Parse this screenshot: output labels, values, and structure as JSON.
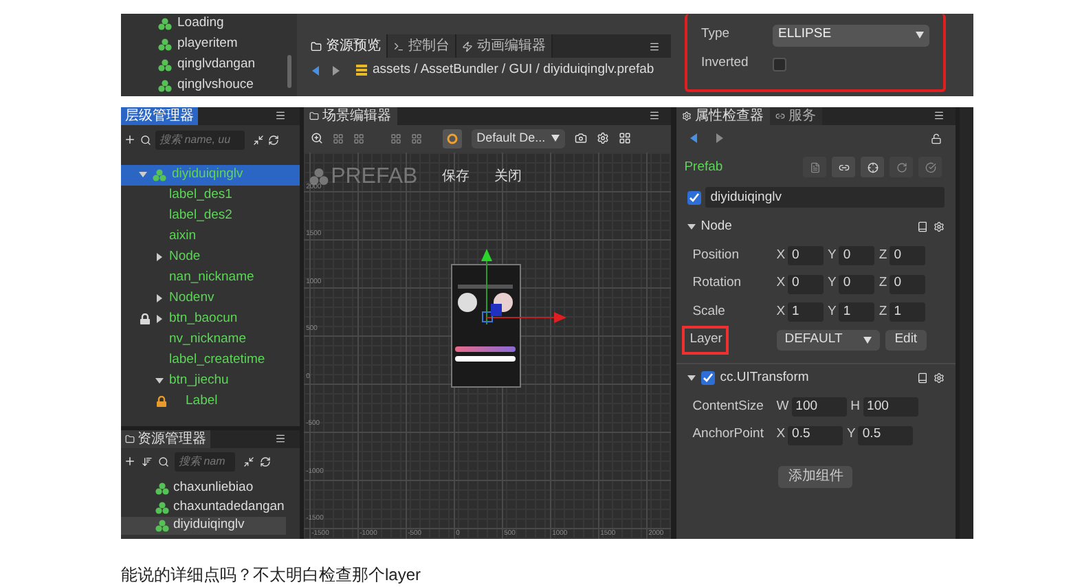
{
  "top_snippet": {
    "tree_items": [
      "Loading",
      "playeritem",
      "qinglvdangan",
      "qinglvshouce"
    ],
    "tabs": [
      {
        "label": "资源预览",
        "selected": true
      },
      {
        "label": "控制台",
        "selected": false
      },
      {
        "label": "动画编辑器",
        "selected": false
      }
    ],
    "breadcrumb": "assets / AssetBundler / GUI / diyiduiqinglv.prefab",
    "highlighted": true,
    "properties": [
      {
        "kind": "select",
        "label": "Type",
        "value": "ELLIPSE"
      },
      {
        "kind": "checkbox",
        "label": "Inverted",
        "checked": false
      }
    ]
  },
  "hierarchy": {
    "title": "层级管理器",
    "search_placeholder": "搜索 name, uu",
    "nodes": [
      {
        "label": "diyiduiqinglv",
        "selected": true,
        "expanded": true,
        "children": [
          {
            "label": "label_des1",
            "selected": false
          },
          {
            "label": "label_des2",
            "selected": false
          },
          {
            "label": "aixin",
            "selected": false
          },
          {
            "label": "Node",
            "selected": false,
            "expanded": false
          },
          {
            "label": "nan_nickname",
            "selected": false
          },
          {
            "label": "Nodenv",
            "selected": false,
            "expanded": false
          },
          {
            "label": "btn_baocun",
            "selected": false,
            "expanded": false,
            "locked": true,
            "color": "#d8d8d8"
          },
          {
            "label": "nv_nickname",
            "selected": false
          },
          {
            "label": "label_createtime",
            "selected": false
          },
          {
            "label": "btn_jiechu",
            "selected": false,
            "expanded": true,
            "children": [
              {
                "label": "Label",
                "selected": false,
                "locked": true,
                "color": "#e89b2c"
              }
            ]
          }
        ]
      }
    ]
  },
  "assets": {
    "title": "资源管理器",
    "search_placeholder": "搜索 nam",
    "items": [
      {
        "label": "chaxunliebiao",
        "selected": false
      },
      {
        "label": "chaxuntadedangan",
        "selected": false
      },
      {
        "label": "diyiduiqinglv",
        "selected": true
      }
    ]
  },
  "scene": {
    "title": "场景编辑器",
    "device": "Default De...",
    "prefab_label": "PREFAB",
    "actions": [
      "保存",
      "关闭"
    ],
    "y_ticks": [
      "2000",
      "1500",
      "1000",
      "500",
      "0",
      "-500",
      "-1000",
      "-1500"
    ],
    "x_ticks": [
      "-1500",
      "-1000",
      "-500",
      "0",
      "500",
      "1000",
      "1500",
      "2000"
    ]
  },
  "inspector": {
    "tabs": [
      {
        "label": "属性检查器",
        "selected": true
      },
      {
        "label": "服务",
        "selected": false
      }
    ],
    "prefab_label": "Prefab",
    "node_name": "diyiduiqinglv",
    "node_enabled": true,
    "sections": [
      {
        "title": "Node",
        "expanded": true,
        "rows": [
          {
            "kind": "vector",
            "label": "Position",
            "fields": [
              {
                "axis": "X",
                "value": "0"
              },
              {
                "axis": "Y",
                "value": "0"
              },
              {
                "axis": "Z",
                "value": "0"
              }
            ]
          },
          {
            "kind": "vector",
            "label": "Rotation",
            "fields": [
              {
                "axis": "X",
                "value": "0"
              },
              {
                "axis": "Y",
                "value": "0"
              },
              {
                "axis": "Z",
                "value": "0"
              }
            ]
          },
          {
            "kind": "vector",
            "label": "Scale",
            "fields": [
              {
                "axis": "X",
                "value": "1"
              },
              {
                "axis": "Y",
                "value": "1"
              },
              {
                "axis": "Z",
                "value": "1"
              }
            ]
          },
          {
            "kind": "select",
            "label": "Layer",
            "value": "DEFAULT",
            "button": "Edit",
            "highlighted": true
          }
        ]
      },
      {
        "title": "cc.UITransform",
        "expanded": true,
        "enabled": true,
        "rows": [
          {
            "kind": "vector",
            "label": "ContentSize",
            "fields": [
              {
                "axis": "W",
                "value": "100"
              },
              {
                "axis": "H",
                "value": "100"
              }
            ]
          },
          {
            "kind": "vector",
            "label": "AnchorPoint",
            "fields": [
              {
                "axis": "X",
                "value": "0.5"
              },
              {
                "axis": "Y",
                "value": "0.5"
              }
            ]
          }
        ]
      }
    ],
    "add_component": "添加组件"
  },
  "comment": "能说的详细点吗？不太明白检查那个layer"
}
